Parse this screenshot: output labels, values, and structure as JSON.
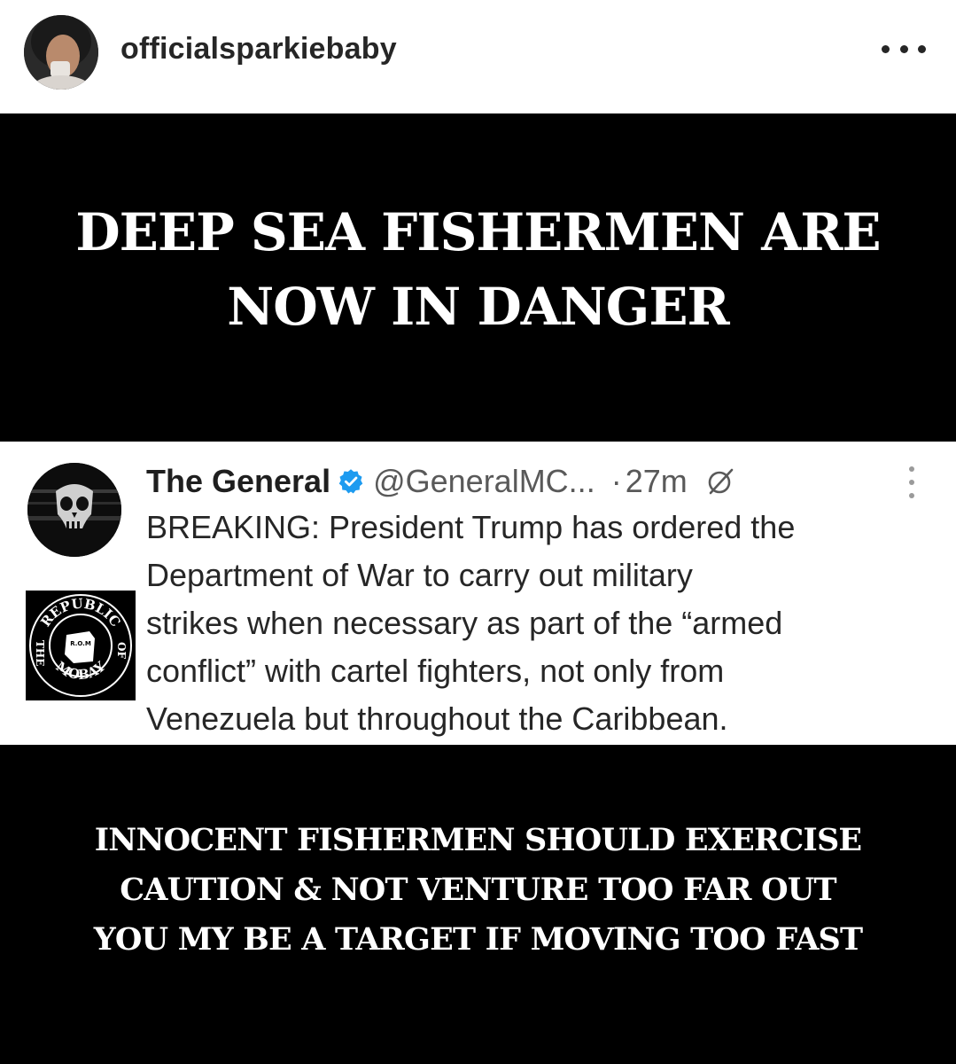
{
  "header": {
    "username": "officialsparkiebaby",
    "more_icon": "more-horizontal-icon"
  },
  "post": {
    "headline": "DEEP SEA FISHERMEN ARE\nNOW IN DANGER",
    "tweet": {
      "name": "The General",
      "handle": "@GeneralMC...",
      "separator": "·",
      "time": "27m",
      "verified_color": "#1d9bf0",
      "logo_text_top": "REPUBLIC",
      "logo_text_left": "THE",
      "logo_text_right": "OF",
      "logo_text_bottom": "MOBAY",
      "logo_initials": "R.O.M",
      "body_lines": [
        "BREAKING: President Trump has ordered the",
        "Department of War to carry out military",
        "strikes when necessary as part of the “armed",
        "conflict” with cartel fighters, not only from",
        "Venezuela but throughout the Caribbean."
      ]
    },
    "footer_lines": [
      "INNOCENT FISHERMEN SHOULD EXERCISE",
      "CAUTION & NOT VENTURE TOO FAR OUT",
      "YOU MY BE A TARGET IF MOVING TOO FAST"
    ]
  }
}
